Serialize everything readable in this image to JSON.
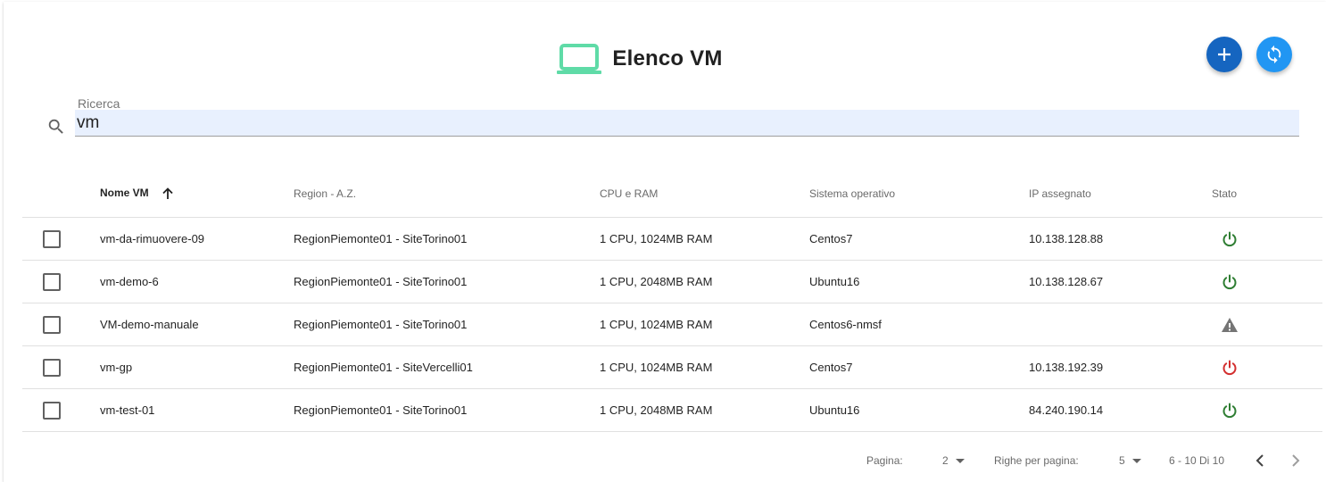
{
  "header": {
    "title": "Elenco VM",
    "icon": "laptop-icon",
    "icon_color": "#5fdba7"
  },
  "actions": {
    "add_icon": "plus-icon",
    "add_color": "#1565c0",
    "refresh_icon": "refresh-icon",
    "refresh_color": "#2196f3"
  },
  "search": {
    "label": "Ricerca",
    "value": "vm"
  },
  "table": {
    "columns": [
      "Nome VM",
      "Region - A.Z.",
      "CPU e RAM",
      "Sistema operativo",
      "IP assegnato",
      "Stato"
    ],
    "sort_column": "Nome VM",
    "sort_direction": "ascending",
    "rows": [
      {
        "name": "vm-da-rimuovere-09",
        "region": "RegionPiemonte01 - SiteTorino01",
        "cpu_ram": "1 CPU, 1024MB RAM",
        "os": "Centos7",
        "ip": "10.138.128.88",
        "state": "power-on"
      },
      {
        "name": "vm-demo-6",
        "region": "RegionPiemonte01 - SiteTorino01",
        "cpu_ram": "1 CPU, 2048MB RAM",
        "os": "Ubuntu16",
        "ip": "10.138.128.67",
        "state": "power-on"
      },
      {
        "name": "VM-demo-manuale",
        "region": "RegionPiemonte01 - SiteTorino01",
        "cpu_ram": "1 CPU, 1024MB RAM",
        "os": "Centos6-nmsf",
        "ip": "",
        "state": "warning"
      },
      {
        "name": "vm-gp",
        "region": "RegionPiemonte01 - SiteVercelli01",
        "cpu_ram": "1 CPU, 1024MB RAM",
        "os": "Centos7",
        "ip": "10.138.192.39",
        "state": "power-off"
      },
      {
        "name": "vm-test-01",
        "region": "RegionPiemonte01 - SiteTorino01",
        "cpu_ram": "1 CPU, 2048MB RAM",
        "os": "Ubuntu16",
        "ip": "84.240.190.14",
        "state": "power-on"
      }
    ]
  },
  "status_colors": {
    "power-on": "#2e7d32",
    "power-off": "#d32f2f",
    "warning": "#757575"
  },
  "pagination": {
    "page_label": "Pagina:",
    "page_value": "2",
    "rows_label": "Righe per pagina:",
    "rows_value": "5",
    "range_text": "6 - 10 Di 10"
  }
}
